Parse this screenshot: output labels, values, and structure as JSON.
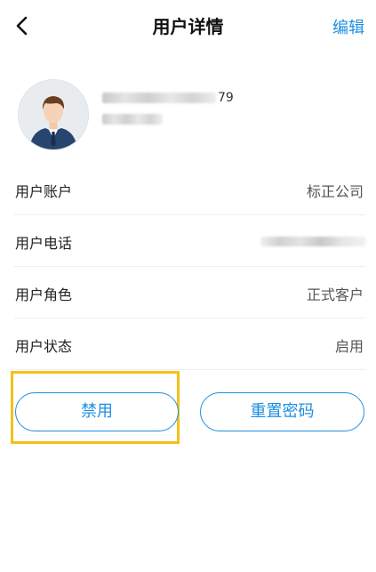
{
  "header": {
    "title": "用户详情",
    "edit_label": "编辑",
    "back_icon": "chevron-left-icon"
  },
  "profile": {
    "avatar_icon": "person-avatar-icon",
    "name_suffix": "79"
  },
  "info": [
    {
      "label": "用户账户",
      "value": "标正公司"
    },
    {
      "label": "用户电话",
      "value": ""
    },
    {
      "label": "用户角色",
      "value": "正式客户"
    },
    {
      "label": "用户状态",
      "value": "启用"
    }
  ],
  "actions": {
    "disable_label": "禁用",
    "reset_password_label": "重置密码"
  },
  "colors": {
    "accent": "#1e8fe1",
    "highlight": "#f4c019"
  }
}
